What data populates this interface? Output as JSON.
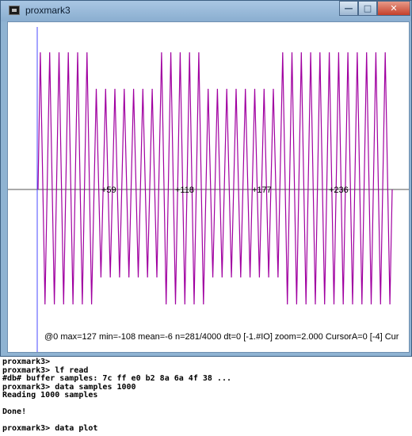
{
  "window": {
    "title": "proxmark3",
    "buttons": {
      "minimize": "—",
      "maximize": "□",
      "close": "✕"
    }
  },
  "plot": {
    "tick_labels": [
      "+59",
      "+118",
      "+177",
      "+236"
    ],
    "status": "@0   max=127 min=-108 mean=-6 n=281/4000    dt=0 [-1.#IO] zoom=2.000 CursorA=0 [-4] Cur",
    "colors": {
      "trace": "#a000a0",
      "axis": "#555555",
      "cursor": "#4a4aff"
    },
    "waveform": {
      "note": "square-wave modulated sine, amplitude levels from trace",
      "segments": [
        {
          "cycles": 6,
          "level": "high"
        },
        {
          "cycles": 7,
          "level": "low"
        },
        {
          "cycles": 5,
          "level": "high"
        },
        {
          "cycles": 8,
          "level": "low"
        },
        {
          "cycles": 12,
          "level": "high"
        }
      ]
    }
  },
  "console": {
    "lines": [
      "proxmark3>",
      "proxmark3> lf read",
      "#db# buffer samples: 7c ff e0 b2 8a 6a 4f 38 ...",
      "proxmark3> data samples 1000",
      "Reading 1000 samples",
      "",
      "Done!",
      "",
      "proxmark3> data plot"
    ]
  }
}
